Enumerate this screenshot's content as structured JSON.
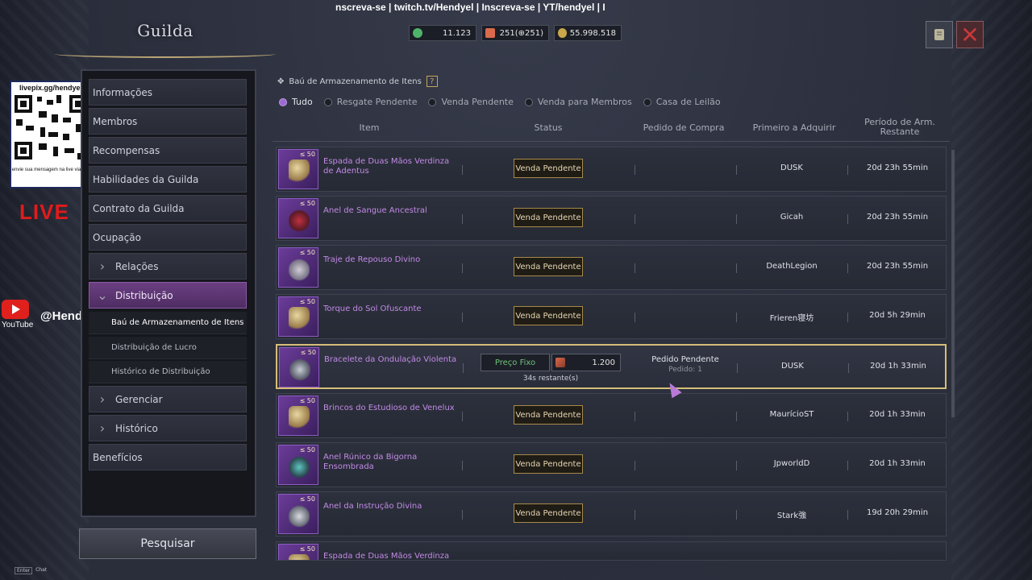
{
  "stream_banner": "nscreva-se  |  twitch.tv/Hendyel  |  Inscreva-se  |   YT/hendyel  |  I",
  "window_title": "Guilda",
  "currencies": [
    {
      "icon": "green-coin-icon",
      "value": "11.123",
      "color": "#4fb36a"
    },
    {
      "icon": "ticket-icon",
      "value": "251(⊕251)",
      "color": "#d96a4c"
    },
    {
      "icon": "gold-coin-icon",
      "value": "55.998.518",
      "color": "#c9a74a"
    }
  ],
  "menu": {
    "items": [
      {
        "label": "Informações"
      },
      {
        "label": "Membros"
      },
      {
        "label": "Recompensas"
      },
      {
        "label": "Habilidades da Guilda"
      },
      {
        "label": "Contrato da Guilda"
      },
      {
        "label": "Ocupação"
      },
      {
        "label": "Relações"
      },
      {
        "label": "Distribuição"
      },
      {
        "label": "Gerenciar"
      },
      {
        "label": "Histórico"
      },
      {
        "label": "Benefícios"
      }
    ],
    "sub_items": [
      {
        "label": "Baú de Armazenamento de Itens"
      },
      {
        "label": "Distribuição de Lucro"
      },
      {
        "label": "Histórico de Distribuição"
      }
    ],
    "search_label": "Pesquisar"
  },
  "overlay": {
    "qr_title": "livepix.gg/hendyel",
    "qr_caption": "envie sua mensagem na live via pix!",
    "live": "LIVE",
    "youtube": "YouTube",
    "handle": "@Hendyel"
  },
  "section": {
    "title": "Baú de Armazenamento de Itens",
    "help": "?",
    "filters": [
      "Tudo",
      "Resgate Pendente",
      "Venda Pendente",
      "Venda para Membros",
      "Casa de Leilão"
    ]
  },
  "table": {
    "headers": [
      "Item",
      "Status",
      "Pedido de Compra",
      "Primeiro a Adquirir",
      "Período de Arm. Restante"
    ],
    "rows": [
      {
        "level": "≤ 50",
        "name": "Espada de Duas Mãos Verdinza de Adentus",
        "status": "Venda Pendente",
        "buyer": "DUSK",
        "period": "20d 23h 55min"
      },
      {
        "level": "≤ 50",
        "name": "Anel de Sangue Ancestral",
        "status": "Venda Pendente",
        "buyer": "Gicah",
        "period": "20d 23h 55min"
      },
      {
        "level": "≤ 50",
        "name": "Traje de Repouso Divino",
        "status": "Venda Pendente",
        "buyer": "DeathLegion",
        "period": "20d 23h 55min"
      },
      {
        "level": "≤ 50",
        "name": "Torque do Sol Ofuscante",
        "status": "Venda Pendente",
        "buyer": "Frieren寝坊",
        "period": "20d 5h 29min"
      },
      {
        "level": "≤ 50",
        "name": "Bracelete da Ondulação Violenta",
        "fixed": "Preço Fixo",
        "price": "1.200",
        "remaining": "34s restante(s)",
        "order": "Pedido Pendente",
        "order_sub": "Pedido: 1",
        "buyer": "DUSK",
        "period": "20d 1h 33min"
      },
      {
        "level": "≤ 50",
        "name": "Brincos do Estudioso de Venelux",
        "status": "Venda Pendente",
        "buyer": "MaurícioST",
        "period": "20d 1h 33min"
      },
      {
        "level": "≤ 50",
        "name": "Anel Rúnico da Bigorna Ensombrada",
        "status": "Venda Pendente",
        "buyer": "JpworldD",
        "period": "20d 1h 33min"
      },
      {
        "level": "≤ 50",
        "name": "Anel da Instrução Divina",
        "status": "Venda Pendente",
        "buyer": "Stark強",
        "period": "19d 20h 29min"
      },
      {
        "level": "≤ 50",
        "name": "Espada de Duas Mãos Verdinza de",
        "status": "",
        "buyer": "",
        "period": ""
      }
    ]
  },
  "chat": {
    "enter": "Enter",
    "label": "Chat"
  }
}
